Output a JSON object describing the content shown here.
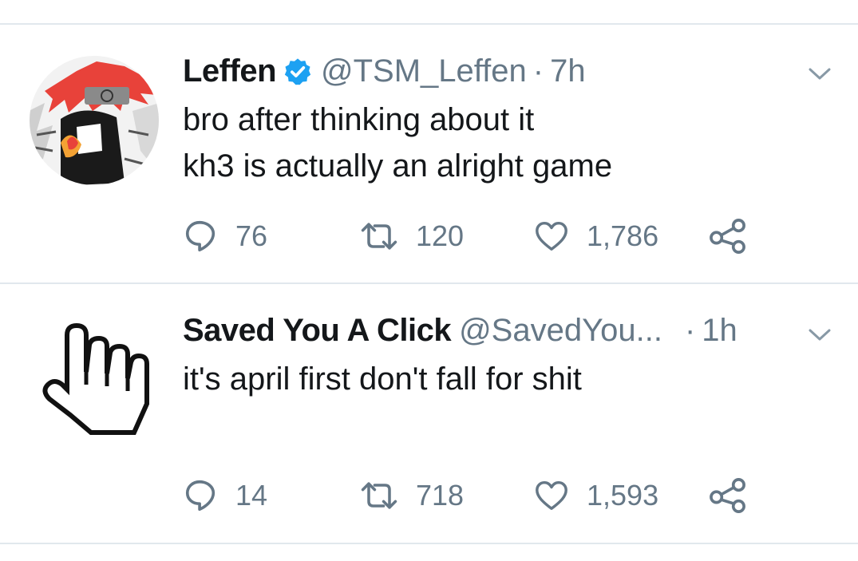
{
  "tweets": [
    {
      "name": "Leffen",
      "verified": true,
      "handle": "@TSM_Leffen",
      "separator": "·",
      "time": "7h",
      "lines": [
        "bro after thinking about it",
        "kh3 is actually an alright game"
      ],
      "replies": "76",
      "retweets": "120",
      "likes": "1,786"
    },
    {
      "name": "Saved You A Click",
      "verified": false,
      "handle": "@SavedYou...",
      "separator": "·",
      "time": "1h",
      "lines": [
        "it's april first don't fall for shit"
      ],
      "replies": "14",
      "retweets": "718",
      "likes": "1,593"
    }
  ],
  "colors": {
    "text": "#14171a",
    "secondary": "#657786",
    "verified": "#1da1f2",
    "divider": "#e1e8ed"
  },
  "icons": [
    "reply-icon",
    "retweet-icon",
    "like-icon",
    "share-icon",
    "chevron-down-icon",
    "verified-badge-icon",
    "pointing-hand-cursor-icon"
  ]
}
